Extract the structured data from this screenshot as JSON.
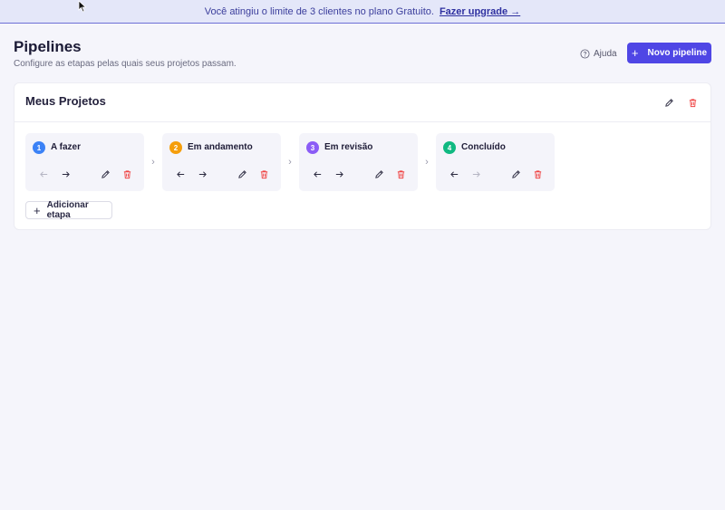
{
  "banner": {
    "message": "Você atingiu o limite de 3 clientes no plano Gratuito.",
    "upgrade_label": "Fazer upgrade →"
  },
  "header": {
    "title": "Pipelines",
    "subtitle": "Configure as etapas pelas quais seus projetos passam.",
    "help_label": "Ajuda",
    "new_pipeline_label": "Novo pipeline"
  },
  "pipeline": {
    "name": "Meus Projetos",
    "add_stage_label": "Adicionar etapa",
    "stages": [
      {
        "number": "1",
        "name": "A fazer",
        "color": "#3b82f6"
      },
      {
        "number": "2",
        "name": "Em andamento",
        "color": "#f59e0b"
      },
      {
        "number": "3",
        "name": "Em revisão",
        "color": "#8b5cf6"
      },
      {
        "number": "4",
        "name": "Concluído",
        "color": "#10b981"
      }
    ]
  },
  "colors": {
    "accent": "#4f46e5",
    "danger": "#ef4444",
    "banner_bg": "#e4e7f9"
  }
}
